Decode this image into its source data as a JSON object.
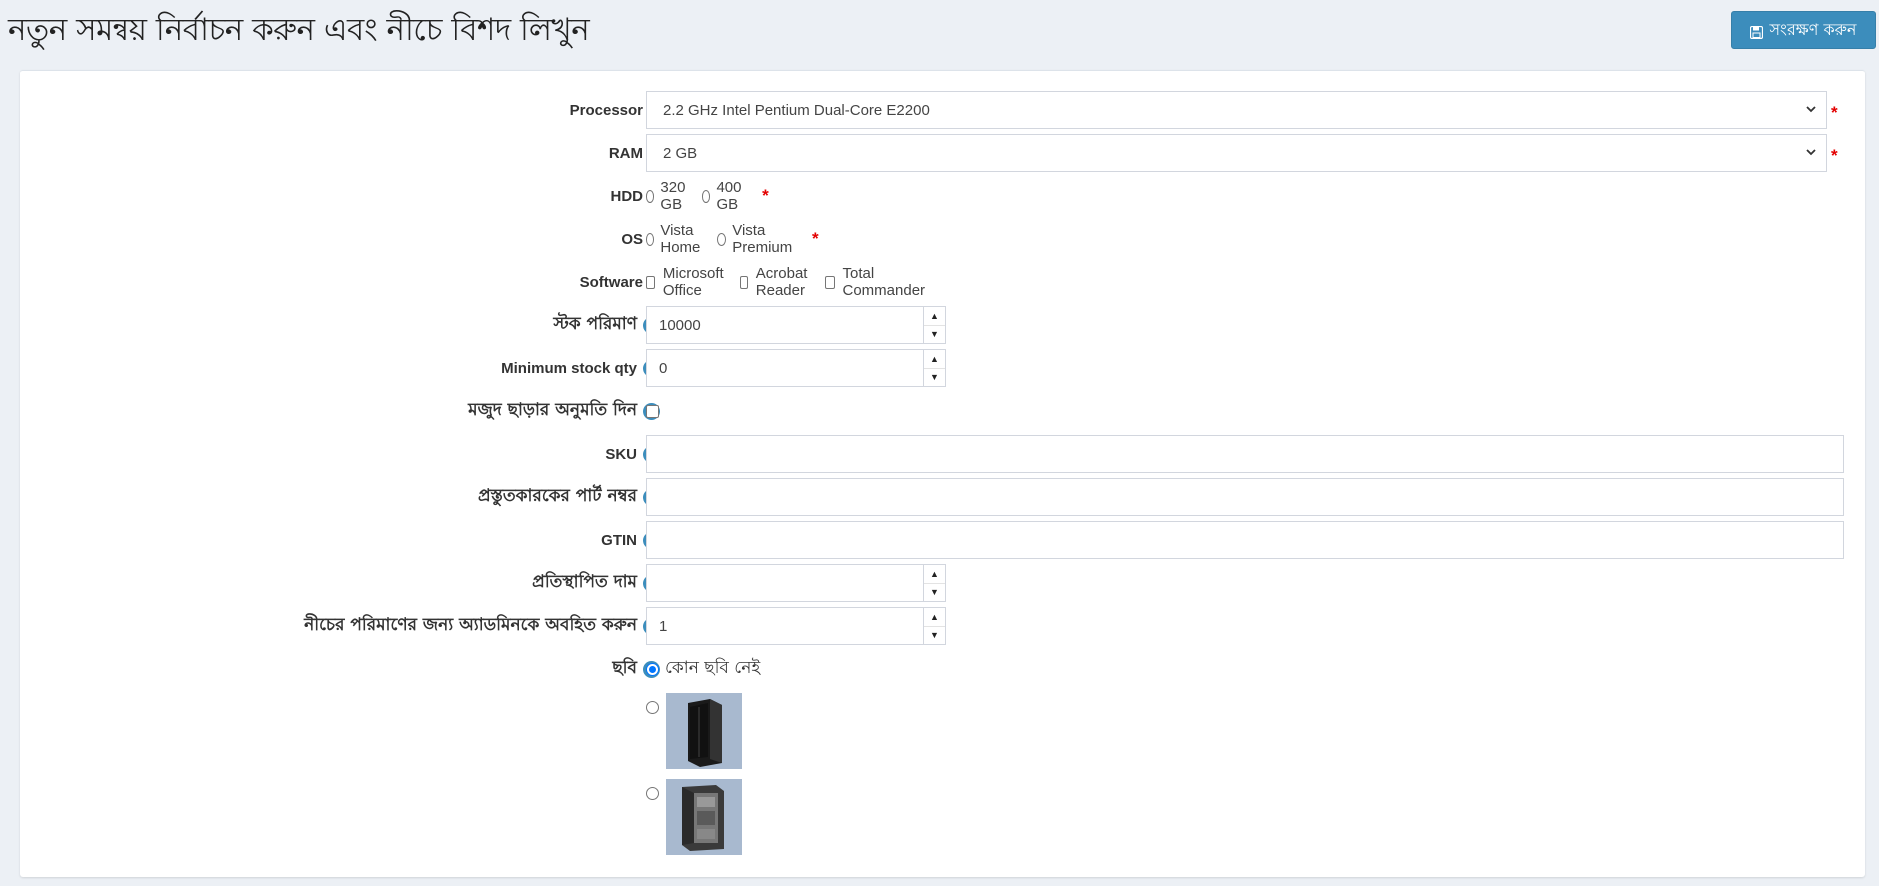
{
  "header": {
    "title": "নতুন সমন্বয় নির্বাচন করুন এবং নীচে বিশদ লিখুন",
    "save_label": "সংরক্ষণ করুন",
    "save_icon": "floppy-disk-icon"
  },
  "form": {
    "processor": {
      "label": "Processor",
      "value": "2.2 GHz Intel Pentium Dual-Core E2200",
      "required_mark": "*"
    },
    "ram": {
      "label": "RAM",
      "value": "2 GB",
      "required_mark": "*"
    },
    "hdd": {
      "label": "HDD",
      "options": [
        "320 GB",
        "400 GB"
      ],
      "required_mark": "*"
    },
    "os": {
      "label": "OS",
      "options": [
        "Vista Home",
        "Vista Premium"
      ],
      "required_mark": "*"
    },
    "software": {
      "label": "Software",
      "options": [
        "Microsoft Office",
        "Acrobat Reader",
        "Total Commander"
      ]
    },
    "stock_qty": {
      "label": "স্টক পরিমাণ",
      "value": "10000"
    },
    "min_stock_qty": {
      "label": "Minimum stock qty",
      "value": "0"
    },
    "allow_out_of_stock": {
      "label": "মজুদ ছাড়ার অনুমতি দিন",
      "checked": false
    },
    "sku": {
      "label": "SKU",
      "value": ""
    },
    "manufacturer_part_number": {
      "label": "প্রস্তুতকারকের পার্ট নম্বর",
      "value": ""
    },
    "gtin": {
      "label": "GTIN",
      "value": ""
    },
    "override_price": {
      "label": "প্রতিস্থাপিত দাম",
      "value": ""
    },
    "notify_admin_qty": {
      "label": "নীচের পরিমাণের জন্য অ্যাডমিনকে অবহিত করুন",
      "value": "1"
    },
    "picture": {
      "label": "ছবি",
      "no_picture_label": "কোন ছবি নেই",
      "selected": "no-picture",
      "thumbnails": [
        "server-tower-black",
        "server-tower-open"
      ]
    }
  },
  "help_icon": "question-circle-icon",
  "colors": {
    "accent": "#3c8dbc",
    "required": "#e30000",
    "background": "#ecf0f5"
  }
}
